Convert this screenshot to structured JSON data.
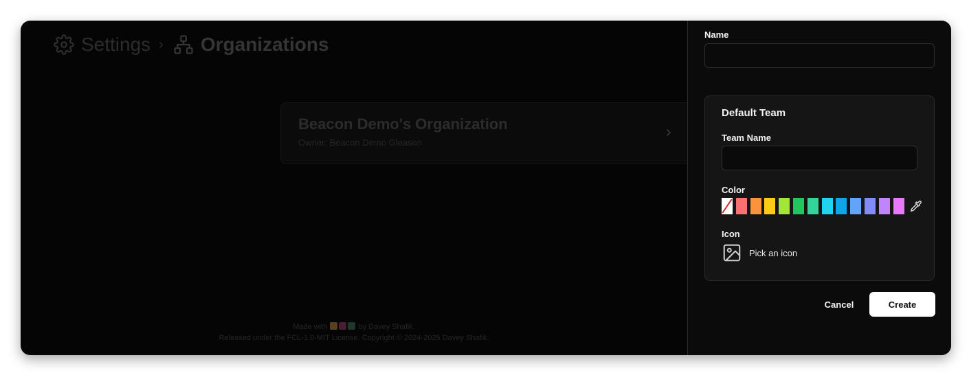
{
  "breadcrumb": {
    "settings_label": "Settings",
    "separator": "›",
    "organizations_label": "Organizations",
    "settings_icon": "gear-icon",
    "organizations_icon": "org-chart-icon"
  },
  "organization_card": {
    "name": "Beacon Demo's Organization",
    "owner": "Owner: Beacon Demo Gleason",
    "chevron_icon": "chevron-right-icon"
  },
  "footer": {
    "made_with": "Made with",
    "by": "by Davey Shafik.",
    "license": "Released under the FCL-1.0-MIT License. Copyright © 2024-2025 Davey Shafik.",
    "emoji_colors": [
      "#e8a23a",
      "#b0306a",
      "#4a8f6a"
    ]
  },
  "panel": {
    "name_label": "Name",
    "name_value": "",
    "default_team": {
      "title": "Default Team",
      "team_name_label": "Team Name",
      "team_name_value": "",
      "color_label": "Color",
      "colors": [
        "none",
        "#f87171",
        "#fb923c",
        "#facc15",
        "#a3e635",
        "#22c55e",
        "#34d399",
        "#22d3ee",
        "#0ea5e9",
        "#60a5fa",
        "#818cf8",
        "#c084fc",
        "#e879f9"
      ],
      "eyedropper_icon": "eyedropper-icon",
      "icon_label": "Icon",
      "pick_icon_label": "Pick an icon",
      "pick_icon_icon": "image-icon"
    },
    "cancel_label": "Cancel",
    "create_label": "Create"
  }
}
